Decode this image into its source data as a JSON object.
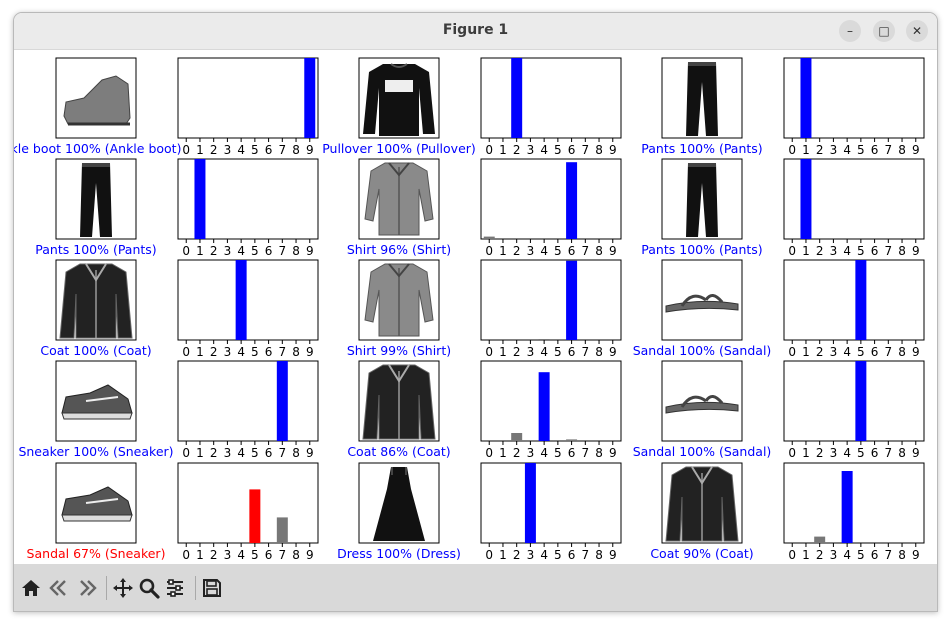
{
  "window": {
    "title": "Figure 1",
    "controls": {
      "minimize": "–",
      "maximize": "□",
      "close": "✕"
    }
  },
  "toolbar": {
    "buttons": [
      "home-icon",
      "back-icon",
      "forward-icon",
      "pan-icon",
      "zoom-icon",
      "configure-subplots-icon",
      "save-icon"
    ]
  },
  "colors": {
    "correct": "#0000ff",
    "incorrect": "#ff0000",
    "other": "#777777"
  },
  "chart_data": {
    "type": "bar",
    "grid": "5 rows x 3 columns of (image, bar chart) pairs",
    "ylim": [
      0,
      1
    ],
    "categories": [
      "0",
      "1",
      "2",
      "3",
      "4",
      "5",
      "6",
      "7",
      "8",
      "9"
    ],
    "panels": [
      {
        "item": "ankle-boot",
        "caption": "kle boot 100% (Ankle boot)",
        "correct": true,
        "values": [
          0,
          0,
          0,
          0,
          0,
          0,
          0,
          0,
          0,
          1.0
        ]
      },
      {
        "item": "pullover",
        "caption": "Pullover 100% (Pullover)",
        "correct": true,
        "values": [
          0,
          0,
          1.0,
          0,
          0,
          0,
          0,
          0,
          0,
          0
        ]
      },
      {
        "item": "pants",
        "caption": "Pants 100% (Pants)",
        "correct": true,
        "values": [
          0,
          1.0,
          0,
          0,
          0,
          0,
          0,
          0,
          0,
          0
        ]
      },
      {
        "item": "pants",
        "caption": "Pants 100% (Pants)",
        "correct": true,
        "values": [
          0,
          1.0,
          0,
          0,
          0,
          0,
          0,
          0,
          0,
          0
        ]
      },
      {
        "item": "shirt",
        "caption": "Shirt 96% (Shirt)",
        "correct": true,
        "values": [
          0.03,
          0,
          0,
          0,
          0,
          0,
          0.96,
          0,
          0,
          0
        ]
      },
      {
        "item": "pants",
        "caption": "Pants 100% (Pants)",
        "correct": true,
        "values": [
          0,
          1.0,
          0,
          0,
          0,
          0,
          0,
          0,
          0,
          0
        ]
      },
      {
        "item": "coat",
        "caption": "Coat 100% (Coat)",
        "correct": true,
        "values": [
          0,
          0,
          0,
          0,
          1.0,
          0,
          0,
          0,
          0,
          0
        ]
      },
      {
        "item": "shirt",
        "caption": "Shirt 99% (Shirt)",
        "correct": true,
        "values": [
          0,
          0,
          0,
          0,
          0.005,
          0,
          0.99,
          0,
          0,
          0
        ]
      },
      {
        "item": "sandal",
        "caption": "Sandal 100% (Sandal)",
        "correct": true,
        "values": [
          0,
          0,
          0,
          0,
          0,
          1.0,
          0,
          0,
          0,
          0
        ]
      },
      {
        "item": "sneaker",
        "caption": "Sneaker 100% (Sneaker)",
        "correct": true,
        "values": [
          0,
          0,
          0,
          0,
          0,
          0,
          0,
          1.0,
          0,
          0
        ]
      },
      {
        "item": "coat",
        "caption": "Coat 86% (Coat)",
        "correct": true,
        "values": [
          0,
          0,
          0.1,
          0,
          0.86,
          0,
          0.02,
          0,
          0,
          0
        ]
      },
      {
        "item": "sandal",
        "caption": "Sandal 100% (Sandal)",
        "correct": true,
        "values": [
          0,
          0,
          0,
          0,
          0,
          1.0,
          0,
          0,
          0,
          0
        ]
      },
      {
        "item": "sneaker",
        "caption": "Sandal 67% (Sneaker)",
        "correct": false,
        "predicted": 5,
        "true_label": 7,
        "values": [
          0,
          0,
          0,
          0,
          0,
          0.67,
          0,
          0.32,
          0,
          0
        ]
      },
      {
        "item": "dress",
        "caption": "Dress 100% (Dress)",
        "correct": true,
        "values": [
          0,
          0,
          0,
          1.0,
          0,
          0,
          0,
          0,
          0,
          0
        ]
      },
      {
        "item": "coat",
        "caption": "Coat 90% (Coat)",
        "correct": true,
        "values": [
          0,
          0,
          0.08,
          0,
          0.9,
          0,
          0,
          0,
          0,
          0
        ]
      }
    ]
  }
}
